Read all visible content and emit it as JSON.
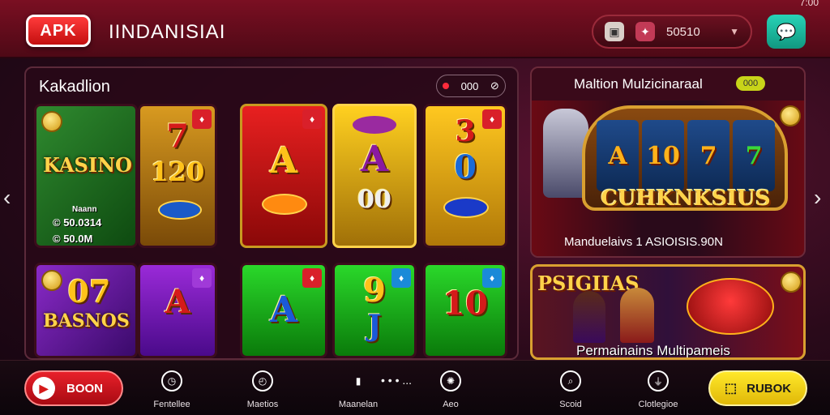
{
  "status": {
    "time": "7:00"
  },
  "header": {
    "logo_text": "APK",
    "app_name": "IINDANISIAI",
    "balance": "50510",
    "colors": {
      "accent": "#7a0f22",
      "chat": "#1fbfa3"
    }
  },
  "main_panel": {
    "title": "Kakadlion",
    "filter_value": "000",
    "tiles": [
      {
        "label": "KASINO",
        "amount1": "© 50.0314",
        "amount2": "© 50.0M",
        "note": "Naann"
      },
      {
        "symbol": "7",
        "symbol2": "120"
      },
      {
        "symbol": "A"
      },
      {
        "symbol": "A",
        "symbol2": "00"
      },
      {
        "symbol": "3",
        "symbol2": "0"
      },
      {
        "label": "BASNOS",
        "symbol": "07"
      },
      {
        "symbol": "A"
      },
      {
        "symbol": "A"
      },
      {
        "symbol": "9",
        "symbol2": "J"
      },
      {
        "symbol": "10"
      }
    ]
  },
  "feature_panel": {
    "title": "Maltion Mulzicinaraal",
    "mini_badge": "000",
    "reels": [
      "A",
      "10",
      "7",
      "7"
    ],
    "big_title": "CUHKNKSIUS",
    "caption": "Manduelaivs 1 ASIOISIS.90N"
  },
  "promo_panel": {
    "title": "PSIGIIAS",
    "caption": "Permainains Multipameis"
  },
  "bottom_nav": {
    "left_button": "BOON",
    "right_button": "RUBOK",
    "items": [
      {
        "label": "Fentellee"
      },
      {
        "label": "Maetios"
      },
      {
        "label": "Maanelan"
      },
      {
        "label": "Aeo"
      },
      {
        "label": "Scoid"
      },
      {
        "label": "Clotlegioe"
      }
    ],
    "center_text": "• • • ..."
  }
}
